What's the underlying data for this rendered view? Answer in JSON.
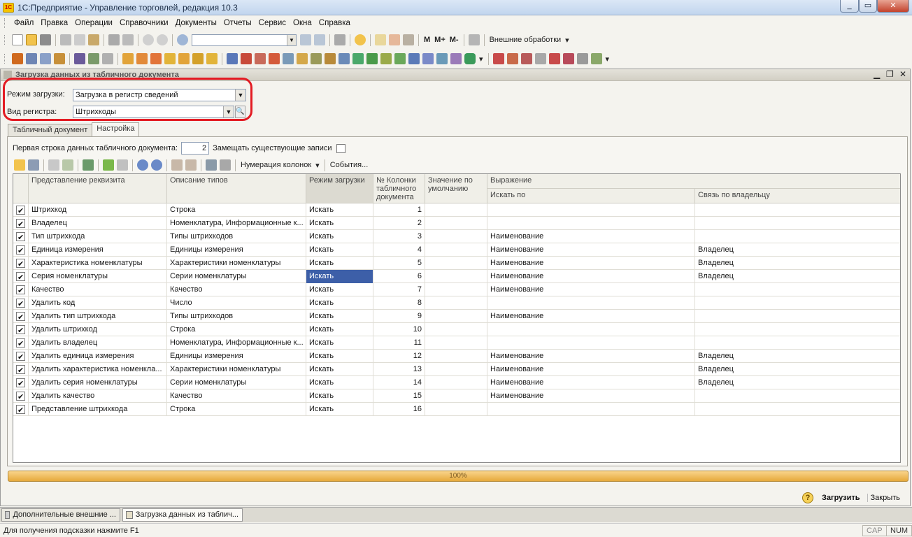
{
  "window": {
    "app_badge": "1С",
    "title": "1С:Предприятие - Управление торговлей, редакция 10.3"
  },
  "menu": [
    "Файл",
    "Правка",
    "Операции",
    "Справочники",
    "Документы",
    "Отчеты",
    "Сервис",
    "Окна",
    "Справка"
  ],
  "toolbar": {
    "calc_m": "M",
    "calc_mplus": "M+",
    "calc_mminus": "M-",
    "external_processing": "Внешние обработки"
  },
  "document": {
    "title": "Загрузка данных из табличного документа",
    "load_mode_label": "Режим загрузки:",
    "load_mode_value": "Загрузка в регистр сведений",
    "register_label": "Вид регистра:",
    "register_value": "Штрихкоды",
    "tabs": [
      "Табличный документ",
      "Настройка"
    ],
    "first_row_label": "Первая строка данных табличного документа:",
    "first_row_value": "2",
    "replace_label": "Замещать существующие записи",
    "numbering_label": "Нумерация колонок",
    "events_label": "События...",
    "columns": {
      "prop": "Представление реквизита",
      "types": "Описание типов",
      "mode": "Режим загрузки",
      "col_no": "№ Колонки табличного документа",
      "default": "Значение по умолчанию",
      "expr": "Выражение",
      "search_by": "Искать по",
      "owner_link": "Связь по владельцу"
    },
    "progress": "100%",
    "load_button": "Загрузить",
    "close_button": "Закрыть"
  },
  "rows": [
    {
      "check": true,
      "prop": "Штрихкод",
      "types": "Строка",
      "mode": "Искать",
      "col": "1",
      "search": "",
      "owner": ""
    },
    {
      "check": true,
      "prop": "Владелец",
      "types": "Номенклатура, Информационные к...",
      "mode": "Искать",
      "col": "2",
      "search": "",
      "owner": ""
    },
    {
      "check": true,
      "prop": "Тип штрихкода",
      "types": "Типы штрихкодов",
      "mode": "Искать",
      "col": "3",
      "search": "Наименование",
      "owner": ""
    },
    {
      "check": true,
      "prop": "Единица измерения",
      "types": "Единицы измерения",
      "mode": "Искать",
      "col": "4",
      "search": "Наименование",
      "owner": "Владелец"
    },
    {
      "check": true,
      "prop": "Характеристика номенклатуры",
      "types": "Характеристики номенклатуры",
      "mode": "Искать",
      "col": "5",
      "search": "Наименование",
      "owner": "Владелец"
    },
    {
      "check": true,
      "prop": "Серия номенклатуры",
      "types": "Серии номенклатуры",
      "mode": "Искать",
      "col": "6",
      "search": "Наименование",
      "owner": "Владелец",
      "selected": true
    },
    {
      "check": true,
      "prop": "Качество",
      "types": "Качество",
      "mode": "Искать",
      "col": "7",
      "search": "Наименование",
      "owner": ""
    },
    {
      "check": true,
      "prop": "Удалить код",
      "types": "Число",
      "mode": "Искать",
      "col": "8",
      "search": "",
      "owner": ""
    },
    {
      "check": true,
      "prop": "Удалить тип штрихкода",
      "types": "Типы штрихкодов",
      "mode": "Искать",
      "col": "9",
      "search": "Наименование",
      "owner": ""
    },
    {
      "check": true,
      "prop": "Удалить штрихкод",
      "types": "Строка",
      "mode": "Искать",
      "col": "10",
      "search": "",
      "owner": ""
    },
    {
      "check": true,
      "prop": "Удалить владелец",
      "types": "Номенклатура, Информационные к...",
      "mode": "Искать",
      "col": "11",
      "search": "",
      "owner": ""
    },
    {
      "check": true,
      "prop": "Удалить единица измерения",
      "types": "Единицы измерения",
      "mode": "Искать",
      "col": "12",
      "search": "Наименование",
      "owner": "Владелец"
    },
    {
      "check": true,
      "prop": "Удалить характеристика номенкла...",
      "types": "Характеристики номенклатуры",
      "mode": "Искать",
      "col": "13",
      "search": "Наименование",
      "owner": "Владелец"
    },
    {
      "check": true,
      "prop": "Удалить серия номенклатуры",
      "types": "Серии номенклатуры",
      "mode": "Искать",
      "col": "14",
      "search": "Наименование",
      "owner": "Владелец"
    },
    {
      "check": true,
      "prop": "Удалить качество",
      "types": "Качество",
      "mode": "Искать",
      "col": "15",
      "search": "Наименование",
      "owner": ""
    },
    {
      "check": true,
      "prop": "Представление штрихкода",
      "types": "Строка",
      "mode": "Искать",
      "col": "16",
      "search": "",
      "owner": ""
    }
  ],
  "taskbar": [
    "Дополнительные внешние ...",
    "Загрузка данных из таблич..."
  ],
  "status": {
    "hint": "Для получения подсказки нажмите F1",
    "cap": "CAP",
    "num": "NUM"
  },
  "colors": {
    "selection": "#3d5fa8",
    "progress": "#e6a93b",
    "highlight": "#e31b23"
  }
}
